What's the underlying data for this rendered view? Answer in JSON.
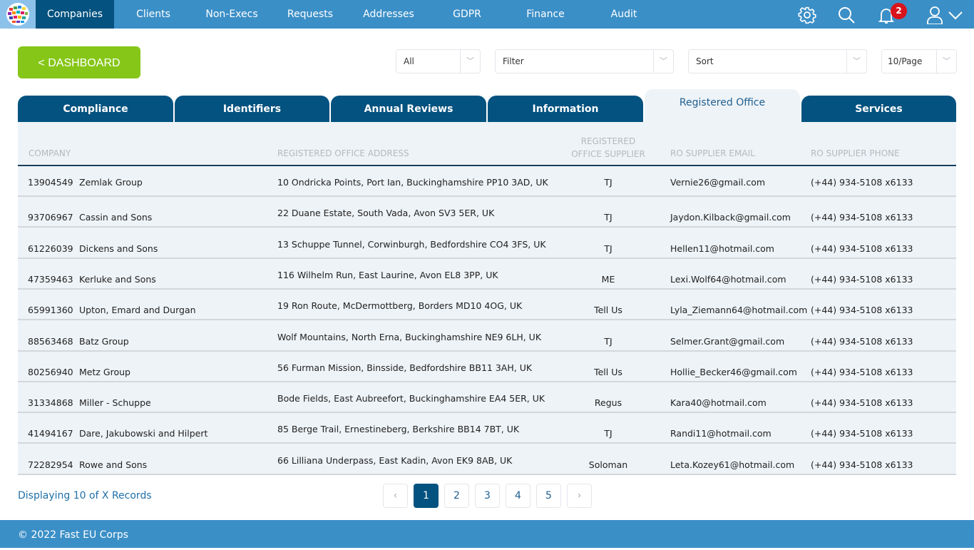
{
  "nav": {
    "items": [
      "Companies",
      "Clients",
      "Non-Execs",
      "Requests",
      "Addresses",
      "GDPR",
      "Finance",
      "Audit"
    ],
    "active": "Companies",
    "notifications": "2"
  },
  "toolbar": {
    "dashboard": "< DASHBOARD",
    "scope": "All",
    "filter": "Filter",
    "sort": "Sort",
    "per_page": "10/Page"
  },
  "tabs": [
    "Compliance",
    "Identifiers",
    "Annual Reviews",
    "Information",
    "Registered Office",
    "Services"
  ],
  "active_tab": "Registered Office",
  "table": {
    "headers": [
      "COMPANY",
      "REGISTERED OFFICE ADDRESS",
      "REGISTERED OFFICE SUPPLIER",
      "RO SUPPLIER EMAIL",
      "RO SUPPLIER PHONE"
    ],
    "rows": [
      [
        "13904549",
        "Zemlak Group",
        "10 Ondricka Points, Port Ian, Buckinghamshire PP10 3AD, UK",
        "TJ",
        "Vernie26@gmail.com",
        "(+44) 934-5108 x6133"
      ],
      [
        "93706967",
        "Cassin and Sons",
        "22 Duane Estate, South Vada, Avon SV3 5ER, UK",
        "TJ",
        "Jaydon.Kilback@gmail.com",
        "(+44) 934-5108 x6133"
      ],
      [
        "61226039",
        "Dickens and Sons",
        "13 Schuppe Tunnel, Corwinburgh, Bedfordshire CO4 3FS, UK",
        "TJ",
        "Hellen11@hotmail.com",
        "(+44) 934-5108 x6133"
      ],
      [
        "47359463",
        "Kerluke and Sons",
        "116 Wilhelm Run, East Laurine, Avon EL8 3PP, UK",
        "ME",
        "Lexi.Wolf64@hotmail.com",
        "(+44) 934-5108 x6133"
      ],
      [
        "65991360",
        "Upton, Emard and Durgan",
        "19 Ron Route, McDermottberg, Borders MD10 4OG, UK",
        "Tell Us",
        "Lyla_Ziemann64@hotmail.com",
        "(+44) 934-5108 x6133"
      ],
      [
        "88563468",
        "Batz Group",
        "Wolf Mountains, North Erna, Buckinghamshire NE9 6LH, UK",
        "TJ",
        "Selmer.Grant@gmail.com",
        "(+44) 934-5108 x6133"
      ],
      [
        "80256940",
        "Metz Group",
        "56 Furman Mission, Binsside, Bedfordshire BB11 3AH, UK",
        "Tell Us",
        "Hollie_Becker46@gmail.com",
        "(+44) 934-5108 x6133"
      ],
      [
        "31334868",
        "Miller - Schuppe",
        "Bode Fields, East Aubreefort, Buckinghamshire EA4 5ER, UK",
        "Regus",
        "Kara40@hotmail.com",
        "(+44) 934-5108 x6133"
      ],
      [
        "41494167",
        "Dare, Jakubowski and Hilpert",
        "85 Berge Trail, Ernestineberg, Berkshire BB14 7BT, UK",
        "TJ",
        "Randi11@hotmail.com",
        "(+44) 934-5108 x6133"
      ],
      [
        "72282954",
        "Rowe and Sons",
        "66 Lilliana Underpass, East Kadin, Avon EK9 8AB, UK",
        "Soloman",
        "Leta.Kozey61@hotmail.com",
        "(+44) 934-5108 x6133"
      ]
    ]
  },
  "pagination": {
    "info": "Displaying 10 of X Records",
    "pages": [
      "1",
      "2",
      "3",
      "4",
      "5"
    ],
    "current": "1"
  },
  "footer": "© 2022 Fast EU Corps"
}
